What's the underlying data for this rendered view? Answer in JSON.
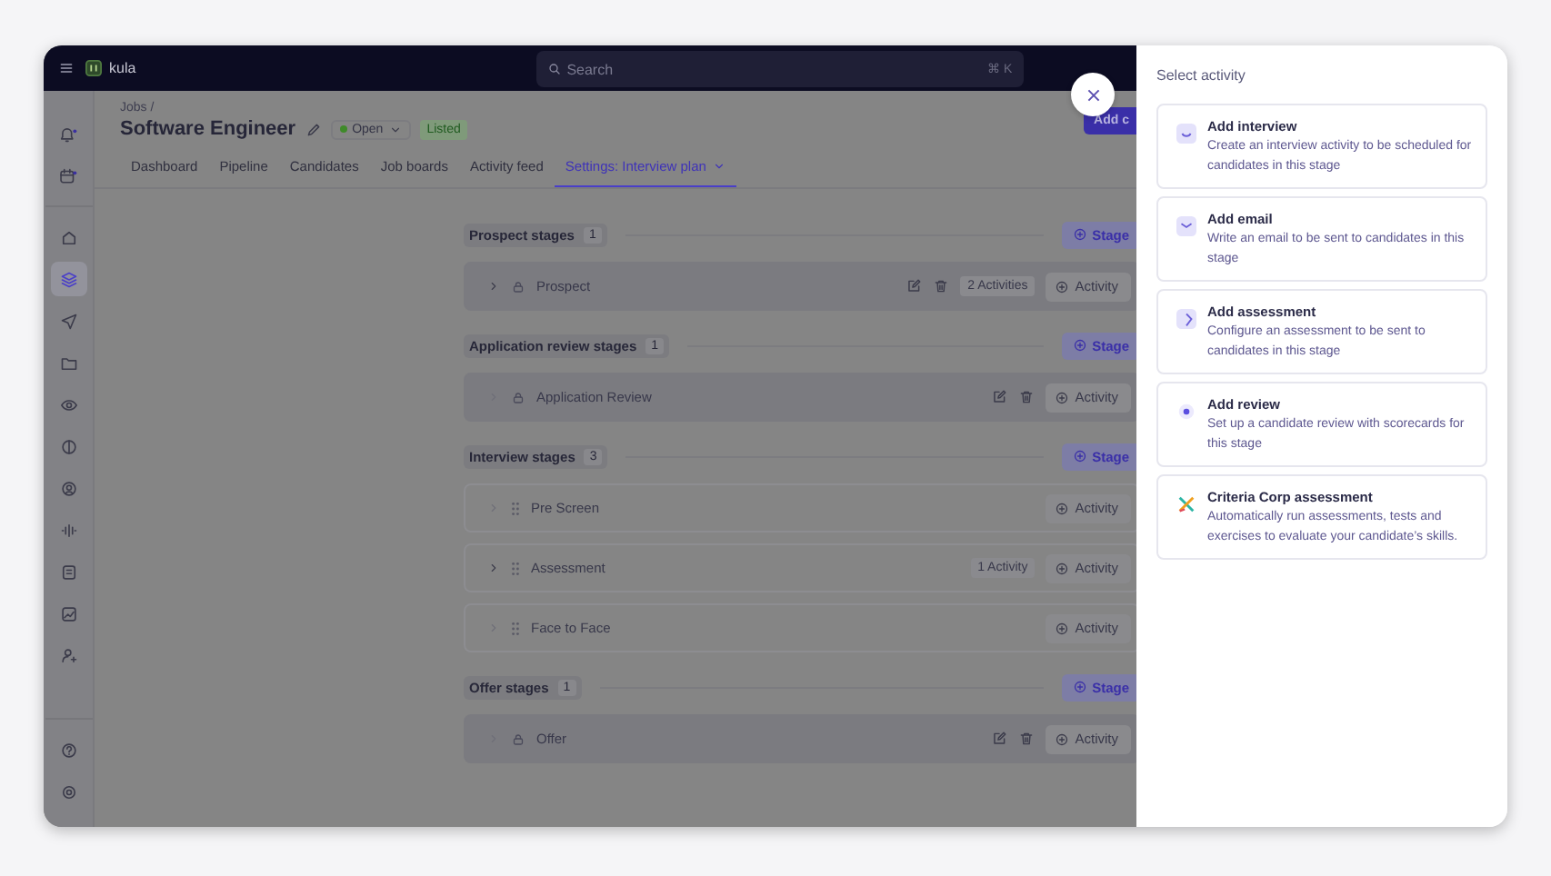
{
  "topbar": {
    "app_name": "kula",
    "search": {
      "placeholder": "Search",
      "shortcut": "⌘ K"
    }
  },
  "sidebar": {
    "top_items": [
      {
        "kind": "bell",
        "notification": true,
        "selected": false
      },
      {
        "kind": "calendar",
        "notification": true,
        "selected": false
      }
    ],
    "items": [
      {
        "kind": "home",
        "selected": false
      },
      {
        "kind": "layers",
        "selected": true
      },
      {
        "kind": "send",
        "selected": false
      },
      {
        "kind": "folder",
        "selected": false
      },
      {
        "kind": "eye",
        "selected": false
      },
      {
        "kind": "half",
        "selected": false
      },
      {
        "kind": "user",
        "selected": false
      },
      {
        "kind": "wave",
        "selected": false
      },
      {
        "kind": "notes",
        "selected": false
      },
      {
        "kind": "chart",
        "selected": false
      },
      {
        "kind": "adduser",
        "selected": false
      }
    ],
    "footer_items": [
      {
        "kind": "help",
        "selected": false
      },
      {
        "kind": "gear",
        "selected": false
      }
    ]
  },
  "header": {
    "breadcrumb": "Jobs /",
    "title": "Software Engineer",
    "status": "Open",
    "badge": "Listed",
    "action": "Add c"
  },
  "tabs": [
    {
      "label": "Dashboard",
      "selected": false
    },
    {
      "label": "Pipeline",
      "selected": false
    },
    {
      "label": "Candidates",
      "selected": false
    },
    {
      "label": "Job boards",
      "selected": false
    },
    {
      "label": "Activity feed",
      "selected": false
    },
    {
      "label": "Settings: Interview plan",
      "selected": true
    }
  ],
  "stage_groups": [
    {
      "title": "Prospect stages",
      "count": "1",
      "button": "Stage",
      "stages": [
        {
          "name": "Prospect",
          "kind": "locked",
          "expandable": true,
          "editable": true,
          "activities": "2 Activities",
          "button": "Activity"
        }
      ]
    },
    {
      "title": "Application review stages",
      "count": "1",
      "button": "Stage",
      "stages": [
        {
          "name": "Application Review",
          "kind": "locked",
          "expandable": false,
          "editable": true,
          "button": "Activity"
        }
      ]
    },
    {
      "title": "Interview stages",
      "count": "3",
      "button": "Stage",
      "stages": [
        {
          "name": "Pre Screen",
          "kind": "draggable",
          "expandable": false,
          "editable": false,
          "button": "Activity"
        },
        {
          "name": "Assessment",
          "kind": "draggable",
          "expandable": true,
          "editable": false,
          "activities": "1 Activity",
          "button": "Activity"
        },
        {
          "name": "Face to Face",
          "kind": "draggable",
          "expandable": false,
          "editable": false,
          "button": "Activity"
        }
      ]
    },
    {
      "title": "Offer stages",
      "count": "1",
      "button": "Stage",
      "stages": [
        {
          "name": "Offer",
          "kind": "locked",
          "expandable": false,
          "editable": true,
          "button": "Activity"
        }
      ]
    }
  ],
  "drawer": {
    "title": "Select activity",
    "options": [
      {
        "kind": "interview",
        "title": "Add interview",
        "description": "Create an interview activity to be scheduled for candidates in this stage"
      },
      {
        "kind": "email",
        "title": "Add email",
        "description": "Write an email to be sent to candidates in this stage"
      },
      {
        "kind": "assessment",
        "title": "Add assessment",
        "description": "Configure an assessment to be sent to candidates in this stage"
      },
      {
        "kind": "review",
        "title": "Add review",
        "description": "Set up a candidate review with scorecards for this stage"
      },
      {
        "kind": "integration",
        "title": "Criteria Corp assessment",
        "description": "Automatically run assessments, tests and exercises to evaluate your candidate’s skills."
      }
    ]
  }
}
